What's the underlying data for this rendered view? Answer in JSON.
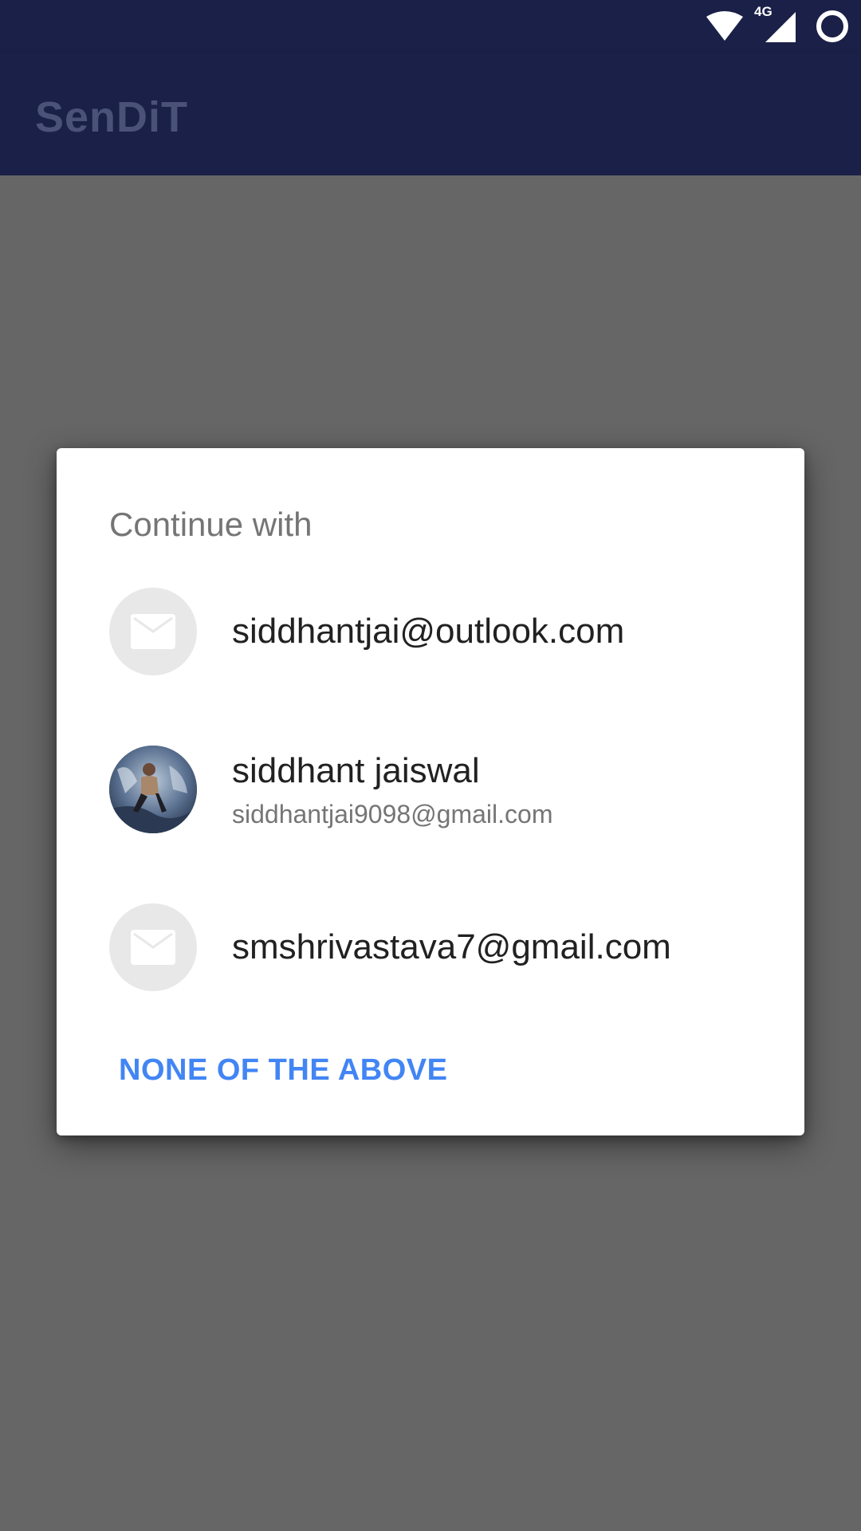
{
  "app": {
    "title": "SenDiT",
    "status_icons": [
      "wifi-icon",
      "signal-4g-icon",
      "battery-circle-icon"
    ],
    "status_network_label": "4G"
  },
  "colors": {
    "primary_dark": "#1a2047",
    "scrim": "#666666",
    "dialog_background": "#ffffff",
    "accent": "#4285f4",
    "avatar_placeholder": "#e8e8e8"
  },
  "dialog": {
    "title": "Continue with",
    "accounts": [
      {
        "primary": "siddhantjai@outlook.com",
        "secondary": "",
        "avatar": "mail-icon"
      },
      {
        "primary": "siddhant jaiswal",
        "secondary": "siddhantjai9098@gmail.com",
        "avatar": "profile-photo"
      },
      {
        "primary": "smshrivastava7@gmail.com",
        "secondary": "",
        "avatar": "mail-icon"
      }
    ],
    "none_button_label": "NONE OF THE ABOVE"
  }
}
